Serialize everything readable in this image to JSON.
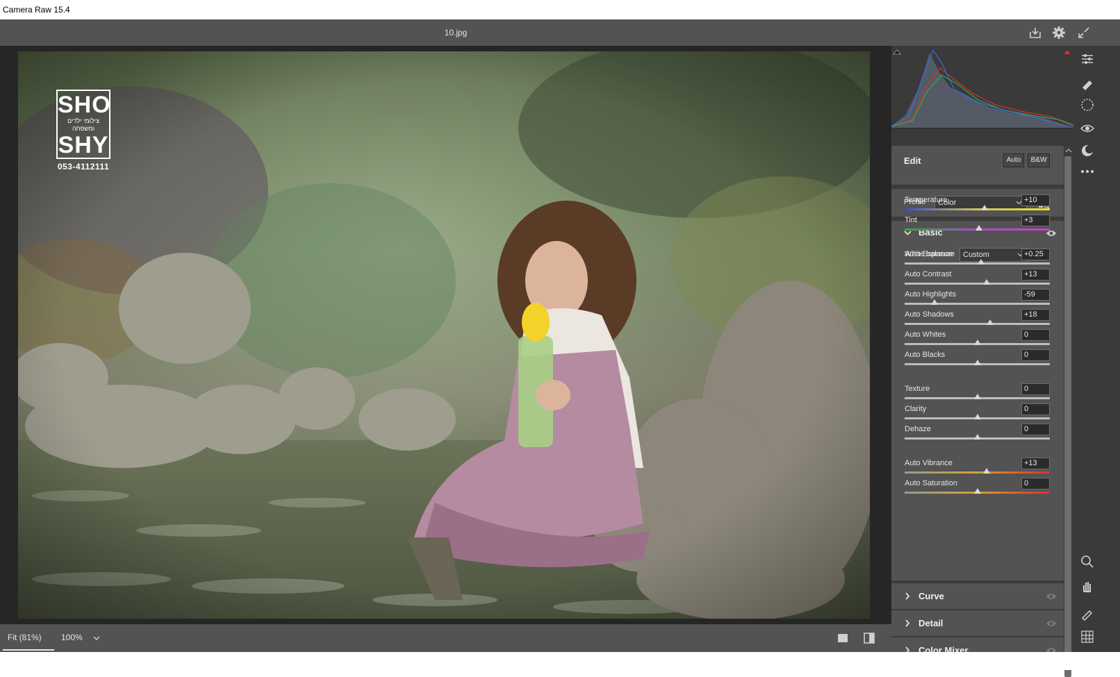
{
  "window": {
    "title": "Camera Raw 15.4"
  },
  "topbar": {
    "filename": "10.jpg",
    "save_icon": "save-icon",
    "settings_icon": "gear-icon",
    "fullscreen_icon": "fullscreen-icon"
  },
  "watermark": {
    "line1": "SHO",
    "subtitle": "צילומי ילדים ומשפחה",
    "line2": "SHY",
    "phone": "053-4112111"
  },
  "bottombar": {
    "fit_label": "Fit (81%)",
    "zoom_label": "100%"
  },
  "edit": {
    "title": "Edit",
    "auto_label": "Auto",
    "bw_label": "B&W"
  },
  "profile": {
    "label": "Profile",
    "value": "Color"
  },
  "basic": {
    "title": "Basic",
    "white_balance": {
      "label": "White balance",
      "value": "Custom"
    },
    "sliders": [
      {
        "name": "Temperature",
        "value": "+10",
        "pos": 0.55
      },
      {
        "name": "Tint",
        "value": "+3",
        "pos": 0.51
      },
      {
        "name": "Auto Exposure",
        "value": "+0.25",
        "pos": 0.525
      },
      {
        "name": "Auto Contrast",
        "value": "+13",
        "pos": 0.565
      },
      {
        "name": "Auto Highlights",
        "value": "-59",
        "pos": 0.205
      },
      {
        "name": "Auto Shadows",
        "value": "+18",
        "pos": 0.59
      },
      {
        "name": "Auto Whites",
        "value": "0",
        "pos": 0.5
      },
      {
        "name": "Auto Blacks",
        "value": "0",
        "pos": 0.5
      },
      {
        "name": "Texture",
        "value": "0",
        "pos": 0.5
      },
      {
        "name": "Clarity",
        "value": "0",
        "pos": 0.5
      },
      {
        "name": "Dehaze",
        "value": "0",
        "pos": 0.5
      },
      {
        "name": "Auto Vibrance",
        "value": "+13",
        "pos": 0.565
      },
      {
        "name": "Auto Saturation",
        "value": "0",
        "pos": 0.5
      }
    ]
  },
  "sections": {
    "curve": "Curve",
    "detail": "Detail",
    "color_mixer": "Color Mixer"
  }
}
